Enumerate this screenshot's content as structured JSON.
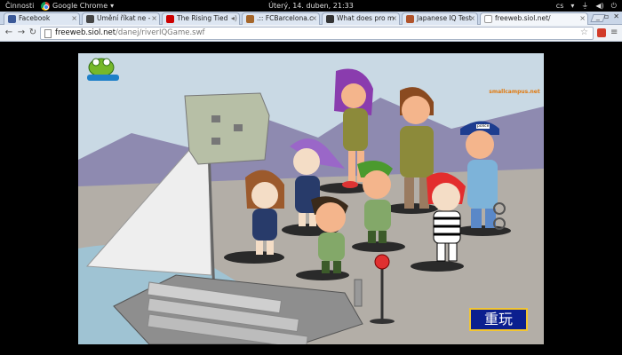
{
  "topbar": {
    "activities": "Činnosti",
    "app_name": "Google Chrome",
    "clock": "Úterý, 14. duben, 21:33",
    "lang": "cs"
  },
  "tabs": [
    {
      "label": "Facebook",
      "icon_color": "#3b5998"
    },
    {
      "label": "Umění říkat ne -",
      "icon_color": "#444444"
    },
    {
      "label": "The Rising Tied",
      "icon_color": "#cc0000"
    },
    {
      "label": ".:: FCBarcelona.c",
      "icon_color": "#a5662a"
    },
    {
      "label": "What does pro m",
      "icon_color": "#333333"
    },
    {
      "label": "Japanese IQ Test",
      "icon_color": "#b0532a"
    },
    {
      "label": "freeweb.siol.net/",
      "icon_color": "#ffffff"
    }
  ],
  "toolbar": {
    "url_host": "freeweb.siol.net",
    "url_path": "/danej/riverIQGame.swf"
  },
  "game": {
    "brand_text": "smallcampus.net",
    "police_label": "police",
    "replay_label": "重玩"
  },
  "colors": {
    "accent_blue": "#0b1f8f",
    "accent_gold": "#f2c531",
    "sky": "#c9d9e4",
    "ground": "#b3aea7",
    "water": "#9fc3d3"
  }
}
